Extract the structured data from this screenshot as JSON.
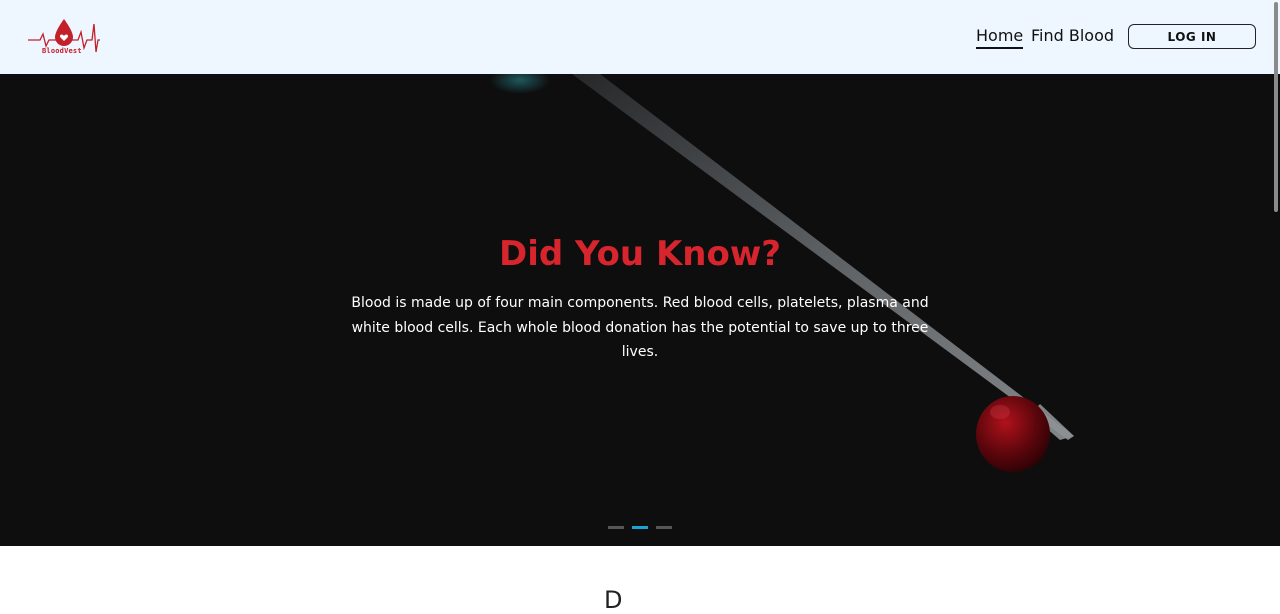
{
  "brand": {
    "logo_text": "BloodVest",
    "primary_color": "#d7252d",
    "logo_icon": "blood-drop-heartbeat-icon"
  },
  "nav": {
    "home": "Home",
    "find_blood": "Find Blood",
    "login": "LOG IN"
  },
  "hero": {
    "title": "Did You Know?",
    "text": "Blood is made up of four main components. Red blood cells, platelets, plasma and white blood cells. Each whole blood donation has the potential to save up to three lives.",
    "slides_total": 3,
    "active_slide": 2,
    "active_indicator_color": "#1aa3cf"
  },
  "next_section": {
    "heading_peek": "D"
  }
}
